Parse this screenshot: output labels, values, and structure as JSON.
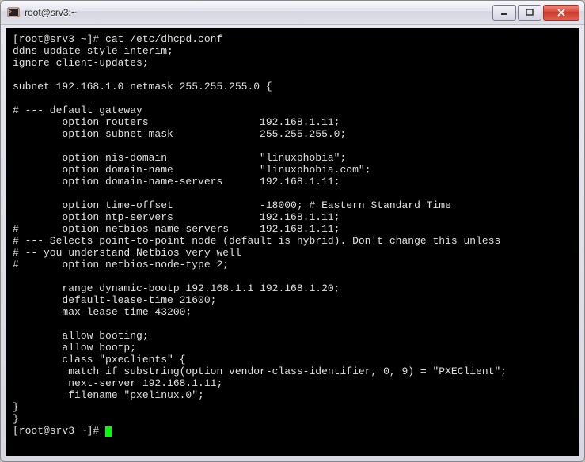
{
  "window": {
    "title": "root@srv3:~"
  },
  "terminal": {
    "prompt": "[root@srv3 ~]#",
    "command": "cat /etc/dhcpd.conf",
    "lines": [
      "ddns-update-style interim;",
      "ignore client-updates;",
      "",
      "subnet 192.168.1.0 netmask 255.255.255.0 {",
      "",
      "# --- default gateway",
      "        option routers                  192.168.1.11;",
      "        option subnet-mask              255.255.255.0;",
      "",
      "        option nis-domain               \"linuxphobia\";",
      "        option domain-name              \"linuxphobia.com\";",
      "        option domain-name-servers      192.168.1.11;",
      "",
      "        option time-offset              -18000; # Eastern Standard Time",
      "        option ntp-servers              192.168.1.11;",
      "#       option netbios-name-servers     192.168.1.11;",
      "# --- Selects point-to-point node (default is hybrid). Don't change this unless",
      "# -- you understand Netbios very well",
      "#       option netbios-node-type 2;",
      "",
      "        range dynamic-bootp 192.168.1.1 192.168.1.20;",
      "        default-lease-time 21600;",
      "        max-lease-time 43200;",
      "",
      "        allow booting;",
      "        allow bootp;",
      "        class \"pxeclients\" {",
      "         match if substring(option vendor-class-identifier, 0, 9) = \"PXEClient\";",
      "         next-server 192.168.1.11;",
      "         filename \"pxelinux.0\";",
      "}",
      "}"
    ],
    "prompt2": "[root@srv3 ~]#"
  }
}
